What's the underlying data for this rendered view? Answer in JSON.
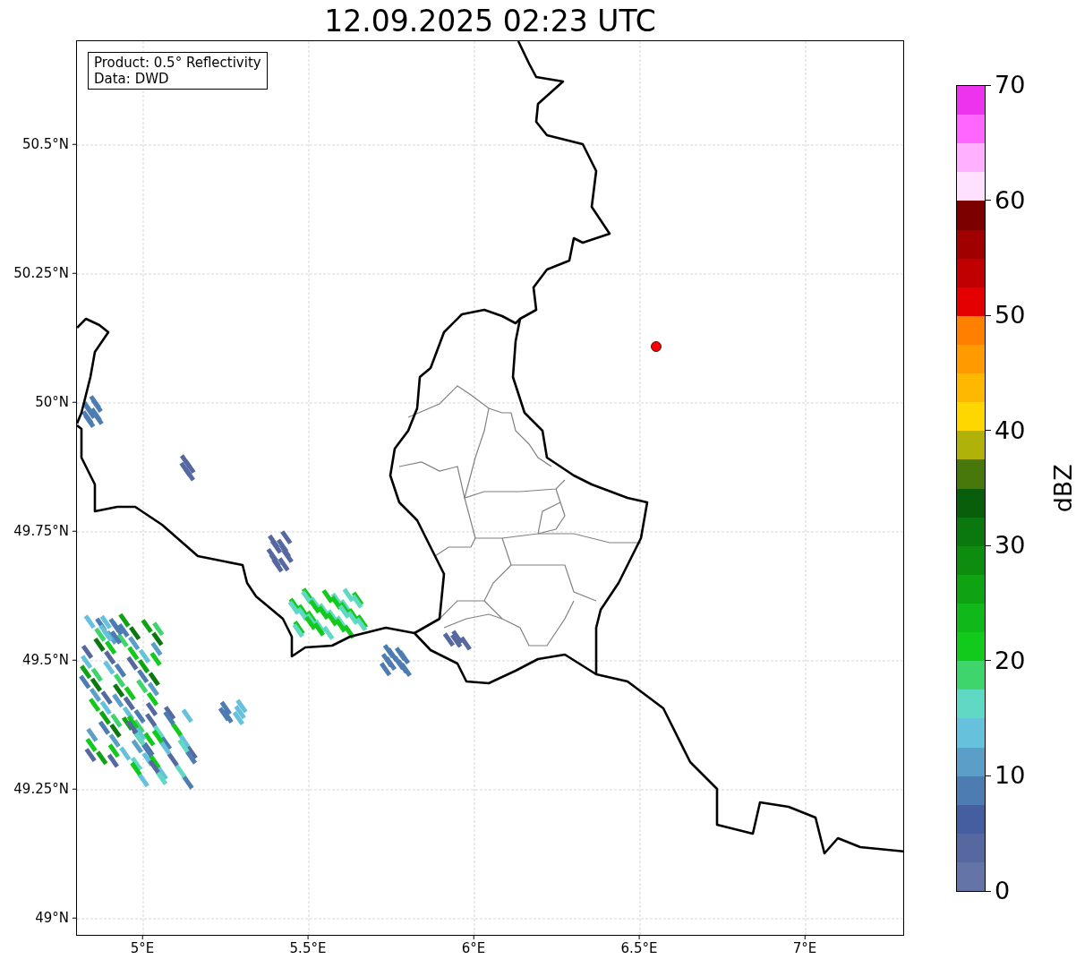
{
  "title": "12.09.2025 02:23 UTC",
  "map": {
    "legend": [
      "Product: 0.5° Reflectivity",
      "Data: DWD"
    ],
    "grid": true,
    "lat_ticks": [
      "50.5°N",
      "50.25°N",
      "50°N",
      "49.75°N",
      "49.5°N",
      "49.25°N",
      "49°N"
    ],
    "lon_ticks": [
      "5°E",
      "5.5°E",
      "6°E",
      "6.5°E",
      "7°E"
    ]
  },
  "colorbar": {
    "label": "dBZ",
    "ticks": [
      "70",
      "60",
      "50",
      "40",
      "30",
      "20",
      "10",
      "0"
    ],
    "bands": [
      {
        "color": "#ee33ee"
      },
      {
        "color": "#ff66ff"
      },
      {
        "color": "#ffb0ff"
      },
      {
        "color": "#ffe0ff"
      },
      {
        "color": "#7c0000"
      },
      {
        "color": "#a00000"
      },
      {
        "color": "#c00000"
      },
      {
        "color": "#e40000"
      },
      {
        "color": "#ff7f00"
      },
      {
        "color": "#ff9a00"
      },
      {
        "color": "#ffb800"
      },
      {
        "color": "#ffd700"
      },
      {
        "color": "#b0b20a"
      },
      {
        "color": "#48780c"
      },
      {
        "color": "#085e0a"
      },
      {
        "color": "#0a780e"
      },
      {
        "color": "#0d8c10"
      },
      {
        "color": "#0fa314"
      },
      {
        "color": "#10b81a"
      },
      {
        "color": "#12ca1c"
      },
      {
        "color": "#3ed66c"
      },
      {
        "color": "#5fd8c4"
      },
      {
        "color": "#66c2dc"
      },
      {
        "color": "#5b9ec8"
      },
      {
        "color": "#4c7cb2"
      },
      {
        "color": "#445ea0"
      },
      {
        "color": "#5668a0"
      },
      {
        "color": "#6474a6"
      }
    ]
  }
}
